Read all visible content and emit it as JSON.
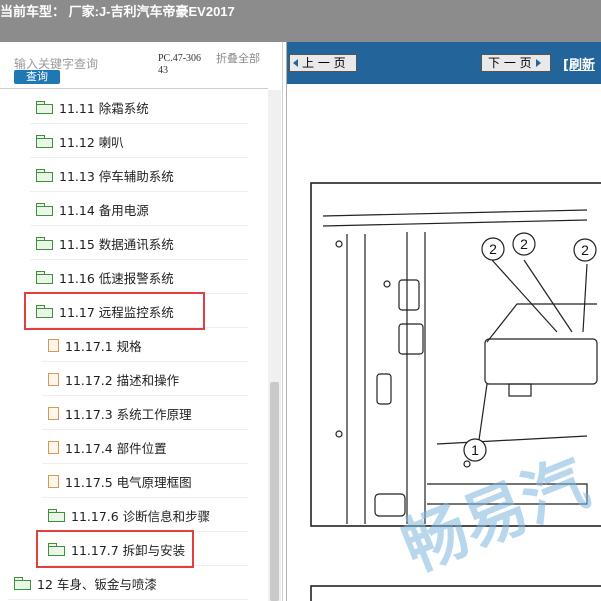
{
  "window": {
    "title": "当前车型：  厂家:J-吉利汽车帝豪EV2017"
  },
  "search": {
    "placeholder": "输入关键字查询",
    "button": "查询",
    "code": "PC.47-30643",
    "collapse": "折叠全部"
  },
  "tree": [
    {
      "label": "11.11 除霜系统",
      "icon": "folder-icon"
    },
    {
      "label": "11.12 喇叭",
      "icon": "folder-icon"
    },
    {
      "label": "11.13 停车辅助系统",
      "icon": "folder-icon"
    },
    {
      "label": "11.14 备用电源",
      "icon": "folder-icon"
    },
    {
      "label": "11.15 数据通讯系统",
      "icon": "folder-icon"
    },
    {
      "label": "11.16 低速报警系统",
      "icon": "folder-icon"
    },
    {
      "label": "11.17 远程监控系统",
      "icon": "folder-open-icon",
      "highlighted": true
    },
    {
      "label": "11.17.1 规格",
      "icon": "page-icon"
    },
    {
      "label": "11.17.2 描述和操作",
      "icon": "page-icon"
    },
    {
      "label": "11.17.3 系统工作原理",
      "icon": "page-icon"
    },
    {
      "label": "11.17.4 部件位置",
      "icon": "page-icon"
    },
    {
      "label": "11.17.5 电气原理框图",
      "icon": "page-icon"
    },
    {
      "label": "11.17.6 诊断信息和步骤",
      "icon": "folder-icon"
    },
    {
      "label": "11.17.7 拆卸与安装",
      "icon": "folder-icon",
      "highlighted": true
    },
    {
      "label": "12 车身、钣金与喷漆",
      "icon": "folder-open-icon"
    }
  ],
  "nav": {
    "prev": "上 一 页",
    "next": "下 一 页",
    "refresh": "[刷新"
  },
  "diagram": {
    "callouts": [
      "2",
      "2",
      "2",
      "1"
    ]
  },
  "watermark": {
    "text": "畅易汽"
  },
  "colors": {
    "titlebar": "#8c8c8c",
    "navbar": "#23649b",
    "highlight": "#e0403f",
    "query_button": "#1f77b4"
  }
}
